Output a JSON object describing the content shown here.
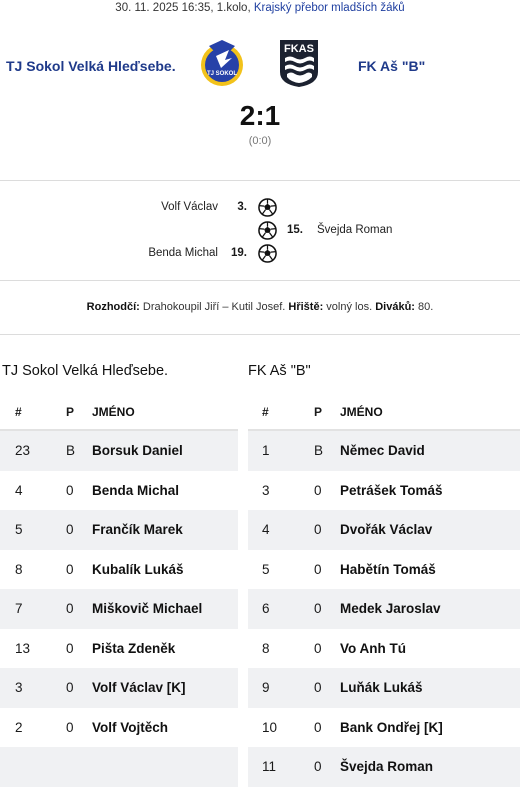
{
  "match": {
    "datetime_round": "30. 11. 2025 16:35, 1.kolo,",
    "competition": "Krajský přebor mladších žáků",
    "home_team": "TJ Sokol Velká Hleďsebe.",
    "away_team": "FK Aš \"B\"",
    "score": "2:1",
    "halftime": "(0:0)"
  },
  "logos": {
    "home_text": "TJ SOKOL",
    "away_text": "FKAS"
  },
  "goals": [
    {
      "player": "Volf Václav",
      "minute": "3.",
      "side": "home"
    },
    {
      "player": "Švejda Roman",
      "minute": "15.",
      "side": "away"
    },
    {
      "player": "Benda Michal",
      "minute": "19.",
      "side": "home"
    }
  ],
  "officials": {
    "referee_label": "Rozhodčí:",
    "referee_value": " Drahokoupil Jiří – Kutil Josef. ",
    "pitch_label": "Hřiště:",
    "pitch_value": " volný los. ",
    "attendance_label": "Diváků:",
    "attendance_value": " 80."
  },
  "lineups": {
    "headers": {
      "num": "#",
      "p": "P",
      "name": "JMÉNO"
    },
    "home": {
      "title": "TJ Sokol Velká Hleďsebe.",
      "players": [
        {
          "num": "23",
          "p": "B",
          "name": "Borsuk Daniel"
        },
        {
          "num": "4",
          "p": "0",
          "name": "Benda Michal"
        },
        {
          "num": "5",
          "p": "0",
          "name": "Frančík Marek"
        },
        {
          "num": "8",
          "p": "0",
          "name": "Kubalík Lukáš"
        },
        {
          "num": "7",
          "p": "0",
          "name": "Miškovič Michael"
        },
        {
          "num": "13",
          "p": "0",
          "name": "Pišta Zdeněk"
        },
        {
          "num": "3",
          "p": "0",
          "name": "Volf Václav [K]"
        },
        {
          "num": "2",
          "p": "0",
          "name": "Volf Vojtěch"
        }
      ]
    },
    "away": {
      "title": "FK Aš \"B\"",
      "players": [
        {
          "num": "1",
          "p": "B",
          "name": "Němec David"
        },
        {
          "num": "3",
          "p": "0",
          "name": "Petrášek Tomáš"
        },
        {
          "num": "4",
          "p": "0",
          "name": "Dvořák Václav"
        },
        {
          "num": "5",
          "p": "0",
          "name": "Habětín Tomáš"
        },
        {
          "num": "6",
          "p": "0",
          "name": "Medek Jaroslav"
        },
        {
          "num": "8",
          "p": "0",
          "name": "Vo Anh Tú"
        },
        {
          "num": "9",
          "p": "0",
          "name": "Luňák Lukáš"
        },
        {
          "num": "10",
          "p": "0",
          "name": "Bank Ondřej [K]"
        },
        {
          "num": "11",
          "p": "0",
          "name": "Švejda Roman"
        }
      ]
    }
  },
  "colors": {
    "accent": "#1f3a8a",
    "link": "#1f3fa0",
    "row_shade": "#f0f1f3"
  }
}
